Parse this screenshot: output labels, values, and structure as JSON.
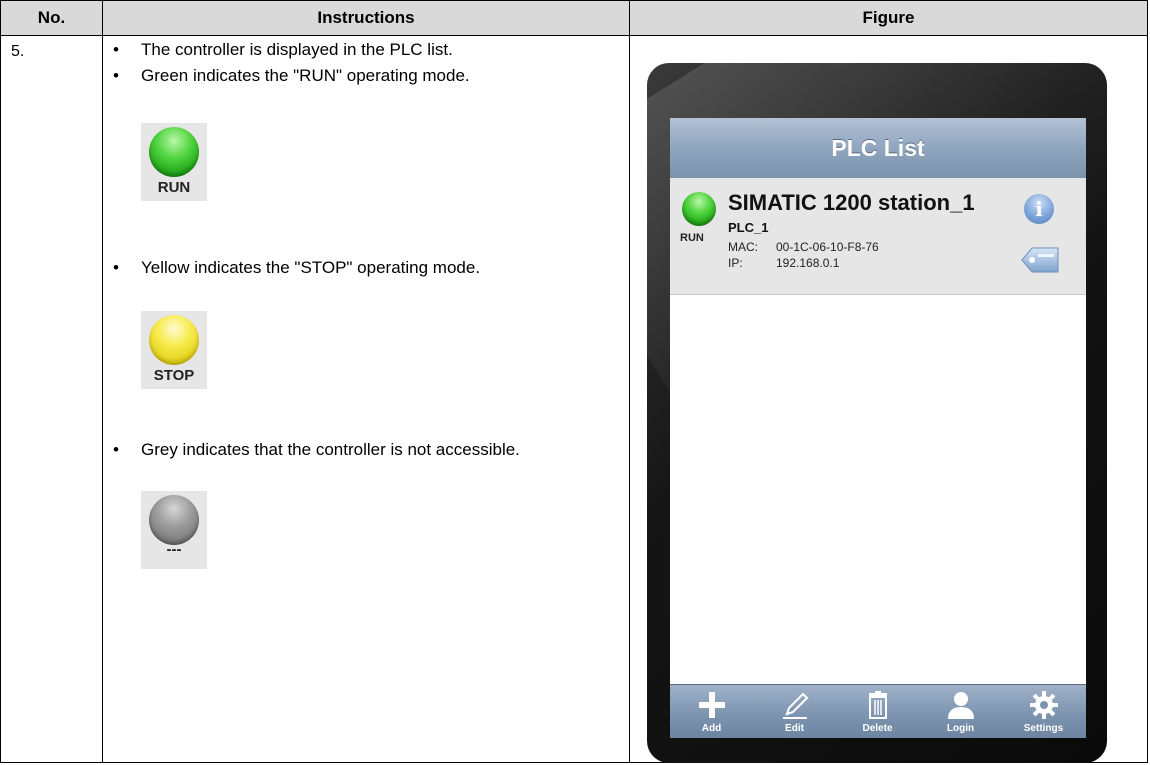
{
  "table": {
    "headers": {
      "no": "No.",
      "instructions": "Instructions",
      "figure": "Figure"
    },
    "row_number": "5."
  },
  "instructions": {
    "bullet1": "The controller is displayed in the PLC list.",
    "bullet2": "Green indicates the \"RUN\" operating mode.",
    "run_label": "RUN",
    "bullet3": "Yellow indicates the \"STOP\" operating mode.",
    "stop_label": "STOP",
    "bullet4": "Grey indicates that the controller is not accessible.",
    "na_label": "---"
  },
  "device": {
    "title": "PLC List",
    "plc": {
      "name": "SIMATIC 1200 station_1",
      "id": "PLC_1",
      "status": "RUN",
      "mac_key": "MAC:",
      "mac_value": "00-1C-06-10-F8-76",
      "ip_key": "IP:",
      "ip_value": "192.168.0.1"
    },
    "tabs": [
      {
        "label": "Add",
        "icon": "plus-icon"
      },
      {
        "label": "Edit",
        "icon": "pencil-icon"
      },
      {
        "label": "Delete",
        "icon": "trash-icon"
      },
      {
        "label": "Login",
        "icon": "user-icon"
      },
      {
        "label": "Settings",
        "icon": "gear-icon"
      }
    ]
  },
  "colors": {
    "header_bg": "#d9d9d9",
    "run": "#2fbf22",
    "stop": "#f0e040",
    "inaccessible": "#8c8c8c",
    "nav_bar": "#8ea2bb"
  }
}
